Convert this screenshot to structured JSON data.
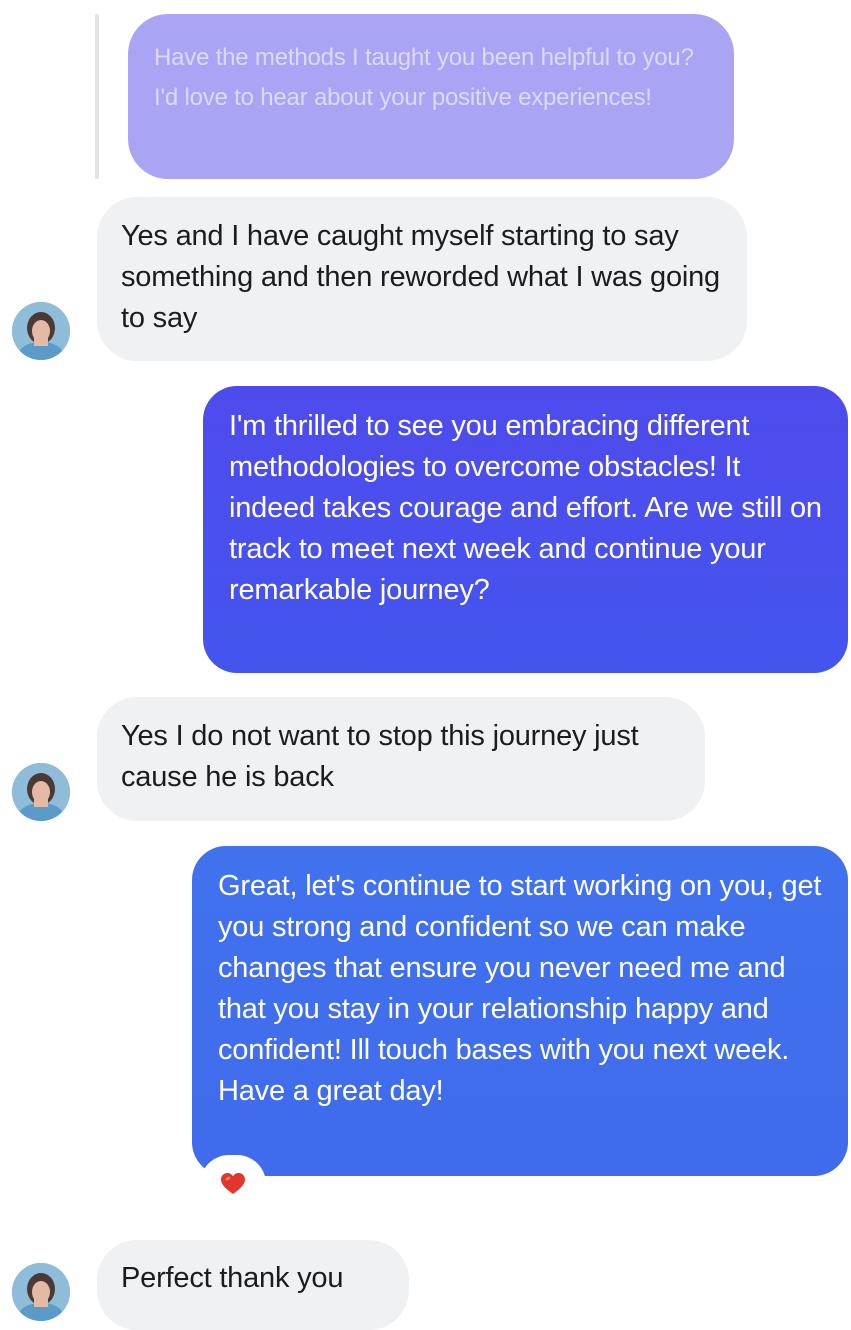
{
  "conversation": {
    "quoted_message": {
      "text": "Have the methods I taught you been helpful to you? I'd love to hear about your positive experiences!"
    },
    "messages": [
      {
        "direction": "incoming",
        "text": "Yes and I have caught myself starting to say something and then reworded what I was going to say"
      },
      {
        "direction": "outgoing",
        "text": "I'm thrilled to see you embracing different methodologies to overcome obstacles! It indeed takes courage and effort. Are we still on track to meet next week and continue your remarkable journey?"
      },
      {
        "direction": "incoming",
        "text": "Yes I do not want to stop this journey just cause he is back"
      },
      {
        "direction": "outgoing",
        "text": "Great, let's continue to start working on you, get you strong and confident so we can make changes that ensure you never need me and that you stay in your relationship happy and confident!  Ill touch bases with you next week.  Have a great day!",
        "reaction": "heart"
      },
      {
        "direction": "incoming",
        "text": "Perfect thank you"
      }
    ]
  },
  "icons": {
    "reaction": "heart-icon",
    "contact_avatar": "avatar"
  },
  "colors": {
    "quoted_bubble": "#aaa4f5",
    "incoming_bubble": "#f0f1f3",
    "outgoing_bubble_1": "#4e4bec",
    "outgoing_bubble_2": "#4172ee",
    "reaction_heart": "#e0362c"
  }
}
